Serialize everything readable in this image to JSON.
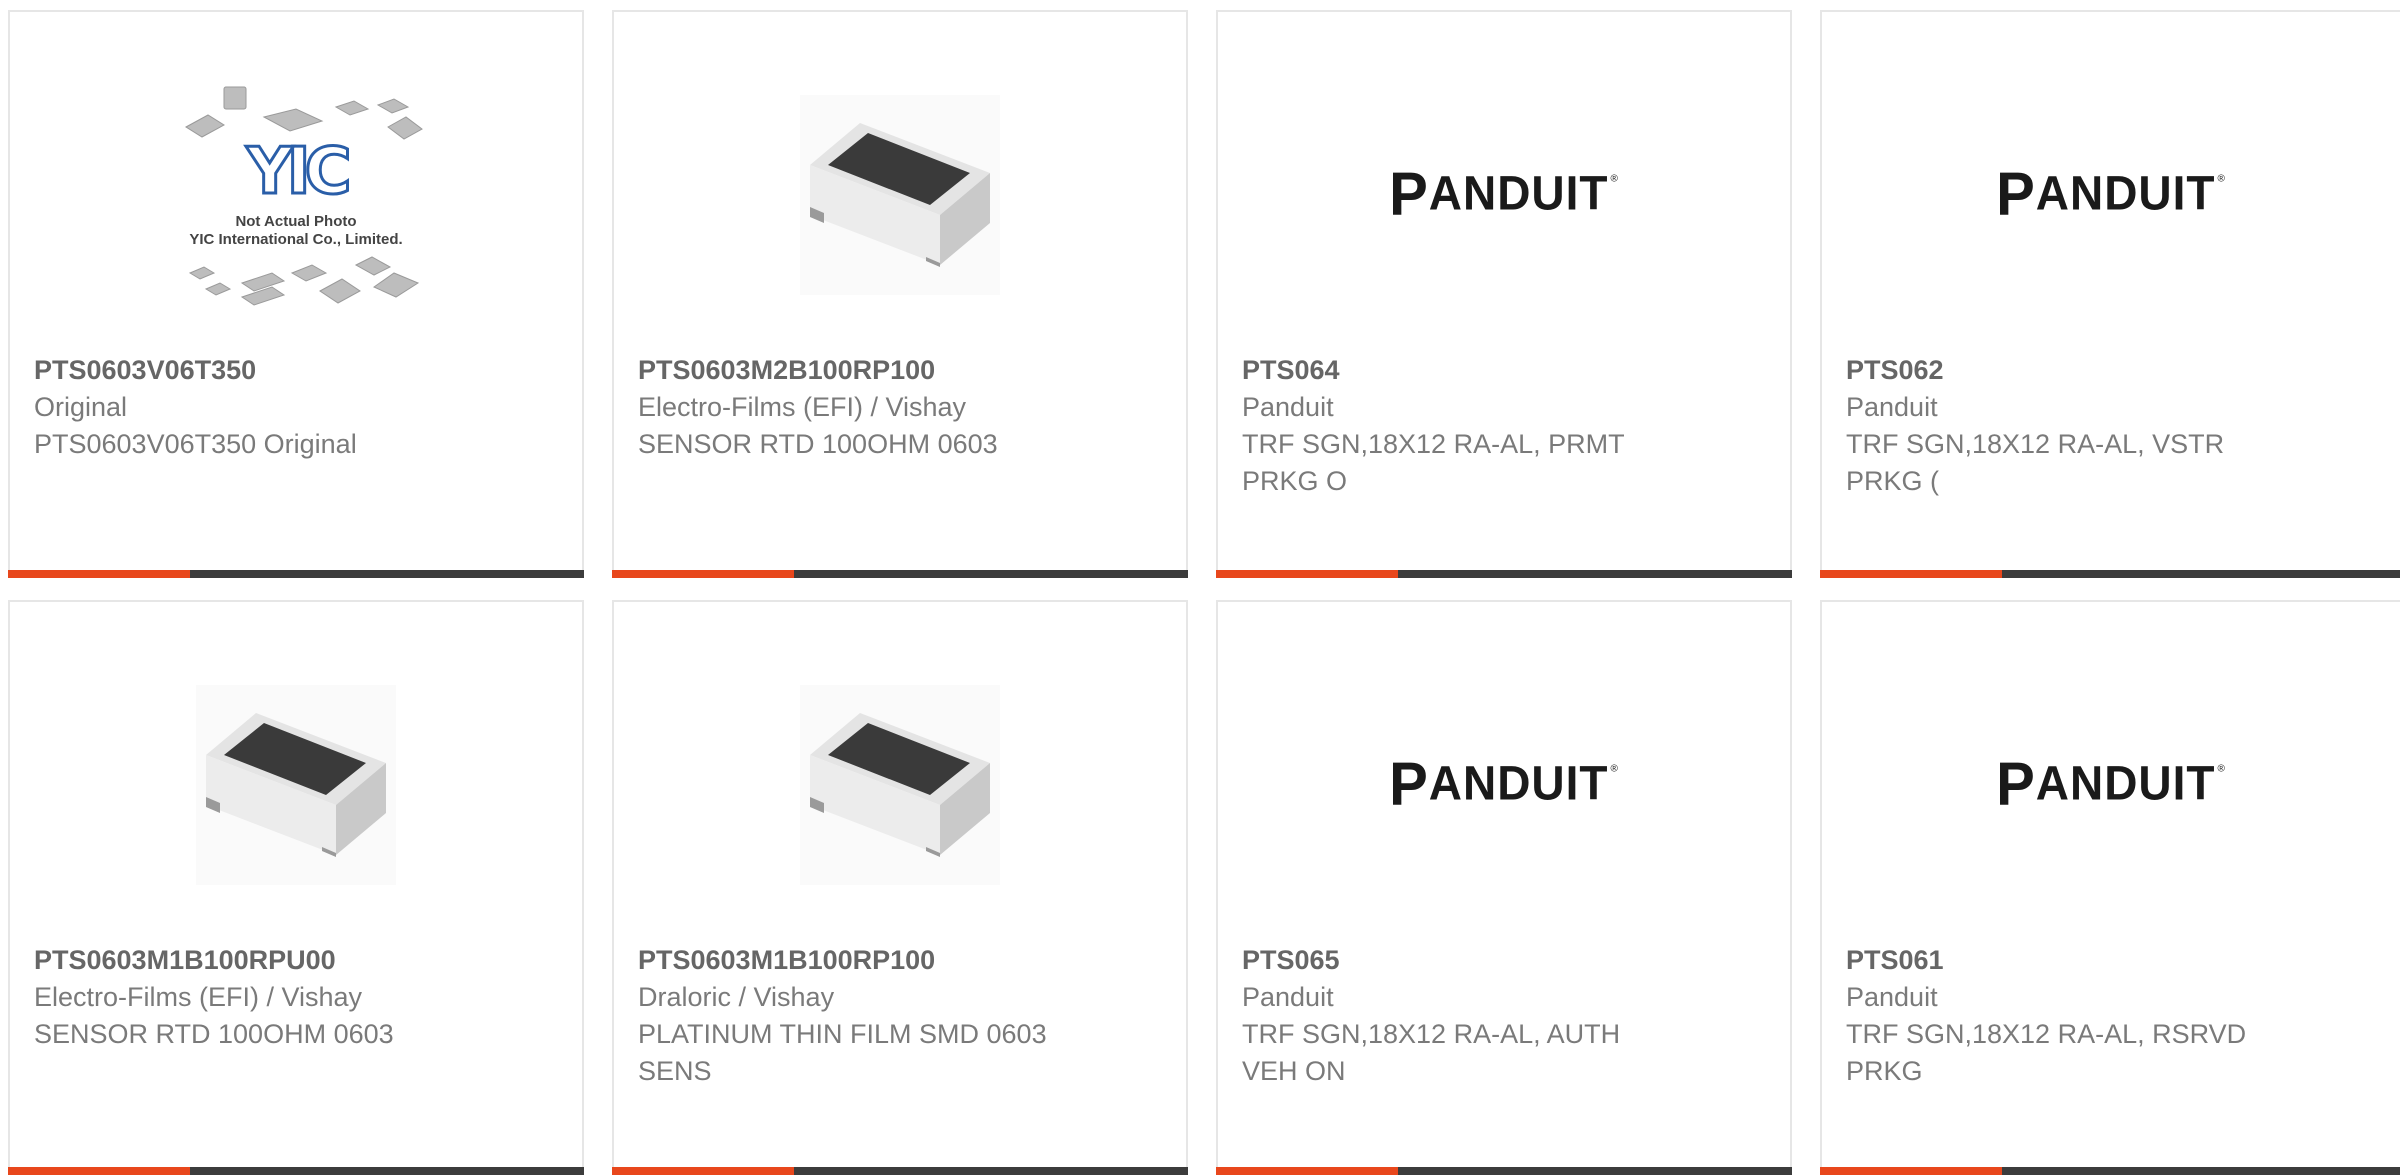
{
  "products": [
    {
      "part_number": "PTS0603V06T350",
      "manufacturer": "Original",
      "description": "PTS0603V06T350 Original",
      "image": "yic-placeholder",
      "placeholder": {
        "line1": "Not Actual Photo",
        "line2": "YIC International Co., Limited.",
        "logo": "YIC"
      }
    },
    {
      "part_number": "PTS0603M2B100RP100",
      "manufacturer": "Electro-Films (EFI) / Vishay",
      "description": "SENSOR RTD 100OHM 0603",
      "image": "smd-chip-resistor"
    },
    {
      "part_number": "PTS064",
      "manufacturer": "Panduit",
      "description": "TRF SGN,18X12 RA-AL, PRMT PRKG O",
      "image": "panduit-logo"
    },
    {
      "part_number": "PTS062",
      "manufacturer": "Panduit",
      "description": "TRF SGN,18X12 RA-AL, VSTR PRKG (",
      "image": "panduit-logo"
    },
    {
      "part_number": "PTS0603M1B100RPU00",
      "manufacturer": "Electro-Films (EFI) / Vishay",
      "description": "SENSOR RTD 100OHM 0603",
      "image": "smd-chip-resistor"
    },
    {
      "part_number": "PTS0603M1B100RP100",
      "manufacturer": "Draloric / Vishay",
      "description": "PLATINUM THIN FILM SMD 0603 SENS",
      "image": "smd-chip-resistor"
    },
    {
      "part_number": "PTS065",
      "manufacturer": "Panduit",
      "description": "TRF SGN,18X12 RA-AL, AUTH VEH ON",
      "image": "panduit-logo"
    },
    {
      "part_number": "PTS061",
      "manufacturer": "Panduit",
      "description": "TRF SGN,18X12 RA-AL, RSRVD PRKG",
      "image": "panduit-logo"
    }
  ],
  "logo_text": {
    "panduit_first": "P",
    "panduit_rest": "ANDUIT",
    "registered": "®"
  },
  "colors": {
    "accent": "#e8471c",
    "bar": "#3c3c3c",
    "border": "#e6e6e6",
    "text": "#777777"
  }
}
